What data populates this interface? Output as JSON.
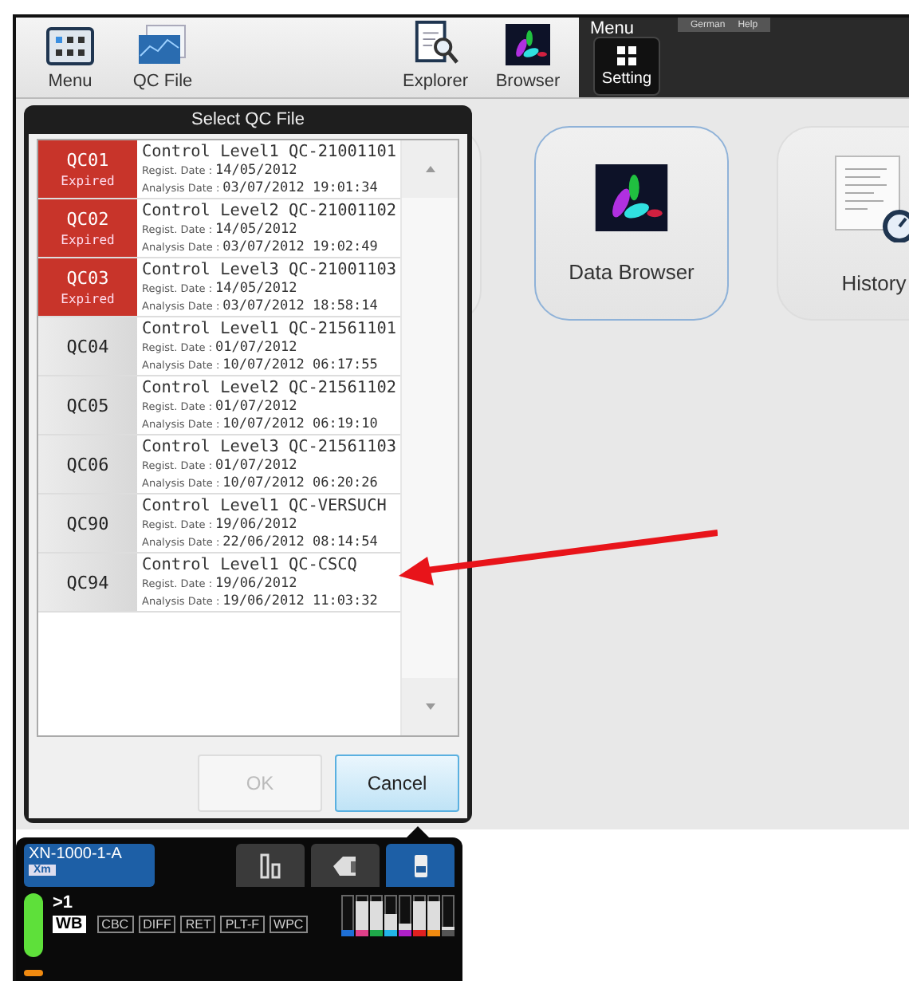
{
  "toolbar": {
    "buttons": [
      {
        "kind": "menu",
        "label": "Menu"
      },
      {
        "kind": "qcfile",
        "label": "QC File"
      },
      {
        "kind": "explorer",
        "label": "Explorer"
      },
      {
        "kind": "browser",
        "label": "Browser"
      }
    ]
  },
  "menu_panel": {
    "title": "Menu",
    "language": "German",
    "help": "Help",
    "buttons": [
      {
        "label": "Setting"
      }
    ]
  },
  "tiles": [
    {
      "kind": "browser",
      "label": "Data Browser",
      "selected": true
    },
    {
      "kind": "history",
      "label": "History",
      "selected": false
    }
  ],
  "dialog": {
    "title": "Select QC File",
    "separator": ":",
    "files": [
      {
        "code": "QC01",
        "expired": true,
        "status": "Expired",
        "name": "Control Level1 QC-21001101",
        "regist_label": "Regist. Date",
        "regist_date": "14/05/2012",
        "analysis_label": "Analysis Date",
        "analysis_date": "03/07/2012 19:01:34"
      },
      {
        "code": "QC02",
        "expired": true,
        "status": "Expired",
        "name": "Control Level2 QC-21001102",
        "regist_label": "Regist. Date",
        "regist_date": "14/05/2012",
        "analysis_label": "Analysis Date",
        "analysis_date": "03/07/2012 19:02:49"
      },
      {
        "code": "QC03",
        "expired": true,
        "status": "Expired",
        "name": "Control Level3 QC-21001103",
        "regist_label": "Regist. Date",
        "regist_date": "14/05/2012",
        "analysis_label": "Analysis Date",
        "analysis_date": "03/07/2012 18:58:14"
      },
      {
        "code": "QC04",
        "expired": false,
        "name": "Control Level1 QC-21561101",
        "regist_label": "Regist. Date",
        "regist_date": "01/07/2012",
        "analysis_label": "Analysis Date",
        "analysis_date": "10/07/2012 06:17:55"
      },
      {
        "code": "QC05",
        "expired": false,
        "name": "Control Level2 QC-21561102",
        "regist_label": "Regist. Date",
        "regist_date": "01/07/2012",
        "analysis_label": "Analysis Date",
        "analysis_date": "10/07/2012 06:19:10"
      },
      {
        "code": "QC06",
        "expired": false,
        "name": "Control Level3 QC-21561103",
        "regist_label": "Regist. Date",
        "regist_date": "01/07/2012",
        "analysis_label": "Analysis Date",
        "analysis_date": "10/07/2012 06:20:26"
      },
      {
        "code": "QC90",
        "expired": false,
        "name": "Control Level1 QC-VERSUCH",
        "regist_label": "Regist. Date",
        "regist_date": "19/06/2012",
        "analysis_label": "Analysis Date",
        "analysis_date": "22/06/2012 08:14:54"
      },
      {
        "code": "QC94",
        "expired": false,
        "name": "Control Level1 QC-CSCQ",
        "regist_label": "Regist. Date",
        "regist_date": "19/06/2012",
        "analysis_label": "Analysis Date",
        "analysis_date": "19/06/2012 11:03:32"
      }
    ],
    "buttons": [
      {
        "label": "OK",
        "disabled": true
      },
      {
        "label": "Cancel",
        "disabled": false
      }
    ]
  },
  "analyzer": {
    "name": "XN-1000-1-A",
    "badge": "Xm",
    "tabs": [
      {
        "kind": "tube",
        "selected": false
      },
      {
        "kind": "hand",
        "selected": false
      },
      {
        "kind": "bottle",
        "selected": true
      }
    ],
    "count": ">1",
    "mode": "WB",
    "channels": [
      "CBC",
      "DIFF",
      "RET",
      "PLT-F",
      "WPC"
    ],
    "reagents": [
      {
        "color": "#1e6fd6",
        "level": 0.15
      },
      {
        "color": "#e0408a",
        "level": 0.85
      },
      {
        "color": "#1faa4a",
        "level": 0.85
      },
      {
        "color": "#22b5e8",
        "level": 0.55
      },
      {
        "color": "#b020c8",
        "level": 0.3
      },
      {
        "color": "#e02020",
        "level": 0.85
      },
      {
        "color": "#f08a10",
        "level": 0.85
      },
      {
        "color": "#555555",
        "level": 0.25
      }
    ]
  }
}
